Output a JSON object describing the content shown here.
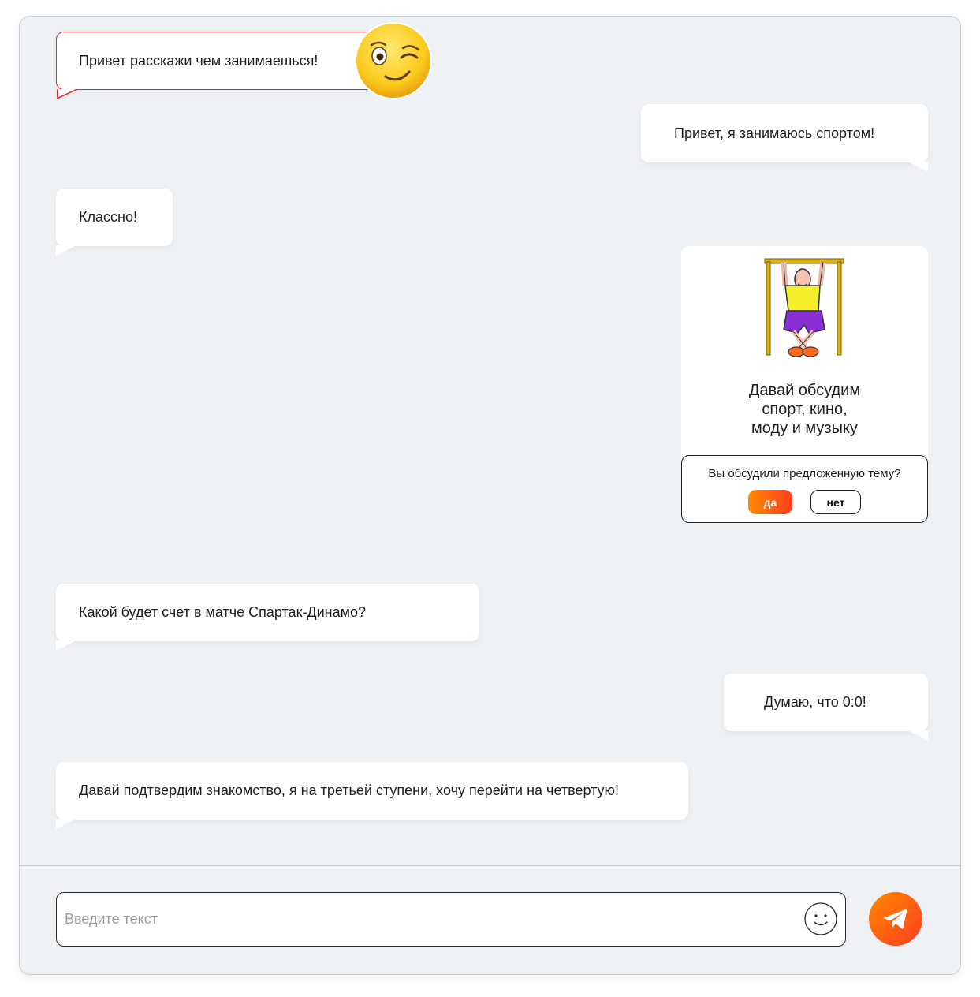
{
  "messages": [
    {
      "side": "in",
      "text": "Привет расскажи чем занимаешься!",
      "highlight": true
    },
    {
      "side": "out",
      "text": "Привет, я занимаюсь спортом!"
    },
    {
      "side": "in",
      "text": "Классно!"
    },
    {
      "side": "in",
      "text": "Какой будет счет в матче Спартак-Динамо?"
    },
    {
      "side": "out",
      "text": "Думаю, что 0:0!"
    },
    {
      "side": "in",
      "text": "Давай подтвердим знакомство, я на третьей ступени, хочу перейти на четвертую!"
    }
  ],
  "topic_card": {
    "lines": [
      "Давай обсудим",
      "спорт, кино,",
      "моду и музыку"
    ],
    "poll_question": "Вы обсудили предложенную тему?",
    "yes_label": "да",
    "no_label": "нет"
  },
  "composer": {
    "placeholder": "Введите текст",
    "value": ""
  },
  "icons": {
    "emoji": "winking-face-icon",
    "smile": "smile-icon",
    "send": "send-icon",
    "illustration": "pull-up-man-illustration"
  },
  "colors": {
    "background": "#eff2f5",
    "bubble": "#ffffff",
    "accent_start": "#ff8a00",
    "accent_end": "#ff3d1f",
    "highlight_border": "#e7232f"
  }
}
